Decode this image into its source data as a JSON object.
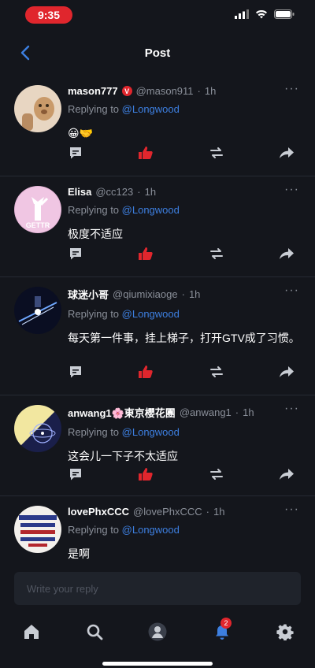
{
  "status_bar": {
    "time": "9:35"
  },
  "header": {
    "title": "Post"
  },
  "posts": [
    {
      "display_name": "mason777",
      "verified": "V",
      "handle": "@mason911",
      "dot": "·",
      "time": "1h",
      "replying_label": "Replying to",
      "replying_to": "@Longwood",
      "content": "😀🤝",
      "more": "···"
    },
    {
      "display_name": "Elisa",
      "handle": "@cc123",
      "dot": "·",
      "time": "1h",
      "replying_label": "Replying to",
      "replying_to": "@Longwood",
      "content": "极度不适应",
      "avatar_text": "GETTR",
      "more": "···"
    },
    {
      "display_name": "球迷小哥",
      "handle": "@qiumixiaoge",
      "dot": "·",
      "time": "1h",
      "replying_label": "Replying to",
      "replying_to": "@Longwood",
      "content": "每天第一件事，挂上梯子，打开GTV成了习惯。",
      "more": "···"
    },
    {
      "display_name": "anwang1🌸東京櫻花團",
      "handle": "@anwang1",
      "dot": "·",
      "time": "1h",
      "replying_label": "Replying to",
      "replying_to": "@Longwood",
      "content": "这会儿一下子不太适应",
      "more": "···"
    },
    {
      "display_name": "lovePhxCCC",
      "handle": "@lovePhxCCC",
      "dot": "·",
      "time": "1h",
      "replying_label": "Replying to",
      "replying_to": "@Longwood",
      "content": "是啊",
      "more": "···"
    }
  ],
  "composer": {
    "placeholder": "Write your reply"
  },
  "tabbar": {
    "notification_count": "2"
  },
  "colors": {
    "background": "#14161c",
    "accent": "#3d7fe0",
    "like": "#e0262d",
    "muted": "#8a8f99"
  }
}
